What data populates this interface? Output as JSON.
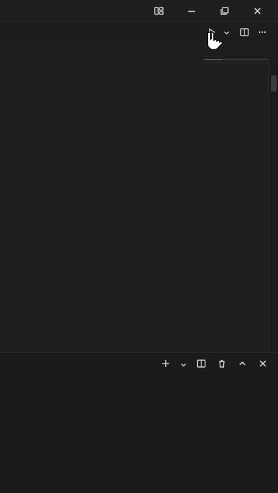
{
  "window": {
    "controls": [
      {
        "name": "layout-icon"
      },
      {
        "name": "minimize-icon"
      },
      {
        "name": "restore-icon"
      },
      {
        "name": "close-icon"
      }
    ]
  },
  "editor_toolbar": {
    "actions": [
      {
        "name": "run-icon"
      },
      {
        "name": "chevron-down-icon"
      },
      {
        "name": "split-editor-icon"
      },
      {
        "name": "more-icon"
      }
    ]
  },
  "panel": {
    "actions": [
      {
        "name": "plus-icon"
      },
      {
        "name": "chevron-down-icon"
      },
      {
        "name": "split-panel-icon"
      },
      {
        "name": "trash-icon"
      },
      {
        "name": "chevron-up-icon"
      },
      {
        "name": "close-panel-icon"
      }
    ]
  },
  "colors": {
    "background": "#1e1e1e",
    "title_bar": "#1f1f1f",
    "panel_background": "#1b1b1b",
    "icon": "#cfcfcf"
  }
}
